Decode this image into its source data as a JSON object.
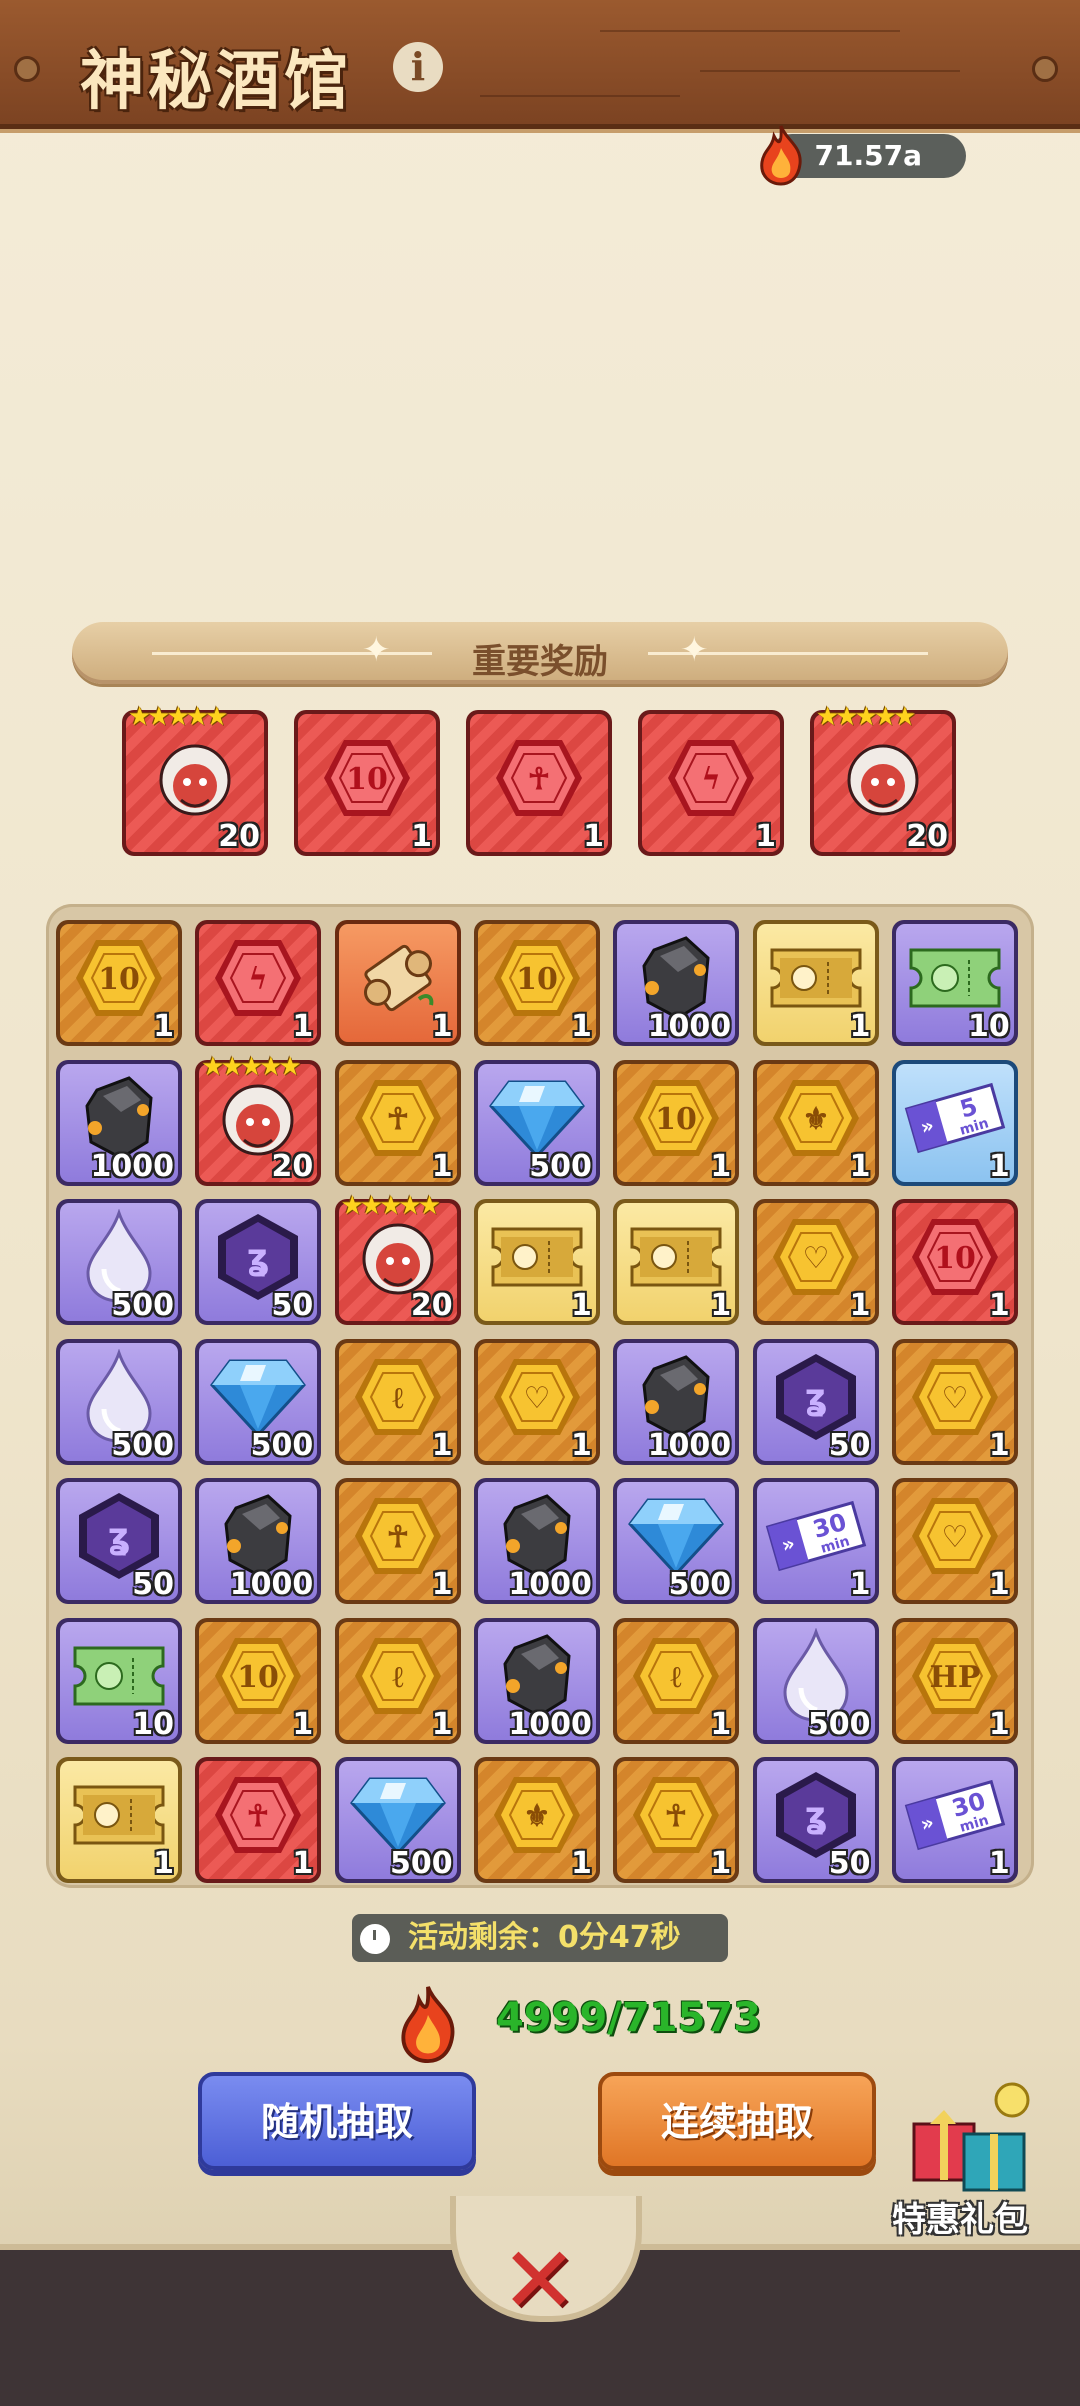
{
  "header": {
    "title": "神秘酒馆",
    "info_icon": "info-icon"
  },
  "currency": {
    "value": "71.57a",
    "icon": "flame-icon"
  },
  "banner": {
    "title": "重要奖励"
  },
  "important_rewards": [
    {
      "type": "hero",
      "stars": "★★★★★",
      "qty": "20",
      "color": "red",
      "icon": "monkey-hero-icon"
    },
    {
      "type": "hex",
      "symbol": "10",
      "qty": "1",
      "color": "red",
      "icon": "red-10-token-icon"
    },
    {
      "type": "hex",
      "symbol": "☥",
      "qty": "1",
      "color": "red",
      "icon": "red-ankh-token-icon"
    },
    {
      "type": "hex",
      "symbol": "ϟ",
      "qty": "1",
      "color": "red",
      "icon": "red-bolt-token-icon"
    },
    {
      "type": "hero",
      "stars": "★★★★★",
      "qty": "20",
      "color": "red",
      "icon": "hooded-reaper-hero-icon"
    }
  ],
  "grid": [
    [
      {
        "c": "gold",
        "k": "hex",
        "s": "10",
        "q": "1",
        "i": "gold-10-token-icon"
      },
      {
        "c": "red",
        "k": "hex",
        "s": "ϟ",
        "q": "1",
        "i": "red-bolt-token-icon"
      },
      {
        "c": "orange",
        "k": "scroll",
        "s": "📜",
        "q": "1",
        "i": "scroll-icon"
      },
      {
        "c": "gold",
        "k": "hex",
        "s": "10",
        "q": "1",
        "i": "gold-10-token-icon"
      },
      {
        "c": "purple",
        "k": "ore",
        "s": "",
        "q": "1000",
        "i": "ore-icon"
      },
      {
        "c": "yellow",
        "k": "ticket",
        "s": "",
        "q": "1",
        "i": "gold-ticket-icon"
      },
      {
        "c": "purple",
        "k": "ticket-green",
        "s": "",
        "q": "10",
        "i": "green-ticket-icon"
      }
    ],
    [
      {
        "c": "purple",
        "k": "ore",
        "s": "",
        "q": "1000",
        "i": "ore-icon"
      },
      {
        "c": "red",
        "k": "hero",
        "s": "",
        "q": "20",
        "i": "hooded-reaper-hero-icon",
        "stars": "★★★★★"
      },
      {
        "c": "gold",
        "k": "hex",
        "s": "☥",
        "q": "1",
        "i": "gold-ankh-token-icon"
      },
      {
        "c": "purple",
        "k": "gem",
        "s": "",
        "q": "500",
        "i": "diamond-icon"
      },
      {
        "c": "gold",
        "k": "hex",
        "s": "10",
        "q": "1",
        "i": "gold-10-token-icon"
      },
      {
        "c": "gold",
        "k": "hex",
        "s": "⚜",
        "q": "1",
        "i": "gold-crest-token-icon"
      },
      {
        "c": "blue",
        "k": "speed",
        "s": "5\nmin",
        "q": "1",
        "i": "speedup-5min-icon"
      }
    ],
    [
      {
        "c": "purple",
        "k": "drop",
        "s": "",
        "q": "500",
        "i": "water-drop-icon"
      },
      {
        "c": "purple",
        "k": "hex-dark",
        "s": "ʓ",
        "q": "50",
        "i": "purple-rune-token-icon"
      },
      {
        "c": "red",
        "k": "hero",
        "s": "",
        "q": "20",
        "i": "monkey-hero-icon",
        "stars": "★★★★★"
      },
      {
        "c": "yellow",
        "k": "ticket",
        "s": "",
        "q": "1",
        "i": "gold-ticket-icon"
      },
      {
        "c": "yellow",
        "k": "ticket",
        "s": "",
        "q": "1",
        "i": "gold-ticket-icon"
      },
      {
        "c": "gold",
        "k": "hex",
        "s": "♡",
        "q": "1",
        "i": "gold-heart-token-icon"
      },
      {
        "c": "red",
        "k": "hex",
        "s": "10",
        "q": "1",
        "i": "red-10-token-icon"
      }
    ],
    [
      {
        "c": "purple",
        "k": "drop",
        "s": "",
        "q": "500",
        "i": "water-drop-icon"
      },
      {
        "c": "purple",
        "k": "gem",
        "s": "",
        "q": "500",
        "i": "diamond-icon"
      },
      {
        "c": "gold",
        "k": "hex",
        "s": "ℓ",
        "q": "1",
        "i": "gold-wing-token-icon"
      },
      {
        "c": "gold",
        "k": "hex",
        "s": "♡",
        "q": "1",
        "i": "gold-heart-token-icon"
      },
      {
        "c": "purple",
        "k": "ore",
        "s": "",
        "q": "1000",
        "i": "ore-icon"
      },
      {
        "c": "purple",
        "k": "hex-dark",
        "s": "ʓ",
        "q": "50",
        "i": "purple-rune-token-icon"
      },
      {
        "c": "gold",
        "k": "hex",
        "s": "♡",
        "q": "1",
        "i": "gold-heart-token-icon"
      }
    ],
    [
      {
        "c": "purple",
        "k": "hex-dark",
        "s": "ʓ",
        "q": "50",
        "i": "purple-rune-token-icon"
      },
      {
        "c": "purple",
        "k": "ore",
        "s": "",
        "q": "1000",
        "i": "ore-icon"
      },
      {
        "c": "gold",
        "k": "hex",
        "s": "☥",
        "q": "1",
        "i": "gold-ankh-token-icon"
      },
      {
        "c": "purple",
        "k": "ore",
        "s": "",
        "q": "1000",
        "i": "ore-icon"
      },
      {
        "c": "purple",
        "k": "gem",
        "s": "",
        "q": "500",
        "i": "diamond-icon"
      },
      {
        "c": "purple",
        "k": "speed",
        "s": "30\nmin",
        "q": "1",
        "i": "speedup-30min-icon"
      },
      {
        "c": "gold",
        "k": "hex",
        "s": "♡",
        "q": "1",
        "i": "gold-heart-token-icon"
      }
    ],
    [
      {
        "c": "purple",
        "k": "ticket-green",
        "s": "",
        "q": "10",
        "i": "green-ticket-icon"
      },
      {
        "c": "gold",
        "k": "hex",
        "s": "10",
        "q": "1",
        "i": "gold-10-token-icon"
      },
      {
        "c": "gold",
        "k": "hex",
        "s": "ℓ",
        "q": "1",
        "i": "gold-wing-token-icon"
      },
      {
        "c": "purple",
        "k": "ore",
        "s": "",
        "q": "1000",
        "i": "ore-icon"
      },
      {
        "c": "gold",
        "k": "hex",
        "s": "ℓ",
        "q": "1",
        "i": "gold-wing-token-icon"
      },
      {
        "c": "purple",
        "k": "drop",
        "s": "",
        "q": "500",
        "i": "water-drop-icon"
      },
      {
        "c": "gold",
        "k": "hex",
        "s": "HP",
        "q": "1",
        "i": "gold-hp-token-icon"
      }
    ],
    [
      {
        "c": "yellow",
        "k": "ticket",
        "s": "",
        "q": "1",
        "i": "gold-ticket-icon"
      },
      {
        "c": "red",
        "k": "hex",
        "s": "☥",
        "q": "1",
        "i": "red-ankh-token-icon"
      },
      {
        "c": "purple",
        "k": "gem",
        "s": "",
        "q": "500",
        "i": "diamond-icon"
      },
      {
        "c": "gold",
        "k": "hex",
        "s": "⚜",
        "q": "1",
        "i": "gold-crest-token-icon"
      },
      {
        "c": "gold",
        "k": "hex",
        "s": "☥",
        "q": "1",
        "i": "gold-ankh-token-icon"
      },
      {
        "c": "purple",
        "k": "hex-dark",
        "s": "ʓ",
        "q": "50",
        "i": "purple-rune-token-icon"
      },
      {
        "c": "purple",
        "k": "speed",
        "s": "30\nmin",
        "q": "1",
        "i": "speedup-30min-icon"
      }
    ]
  ],
  "timer": {
    "text": "活动剩余：0分47秒"
  },
  "draw_count": {
    "text": "4999/71573"
  },
  "buttons": {
    "random": "随机抽取",
    "continuous": "连续抽取"
  },
  "gift": {
    "label": "特惠礼包"
  },
  "close": {
    "symbol": "✕"
  }
}
